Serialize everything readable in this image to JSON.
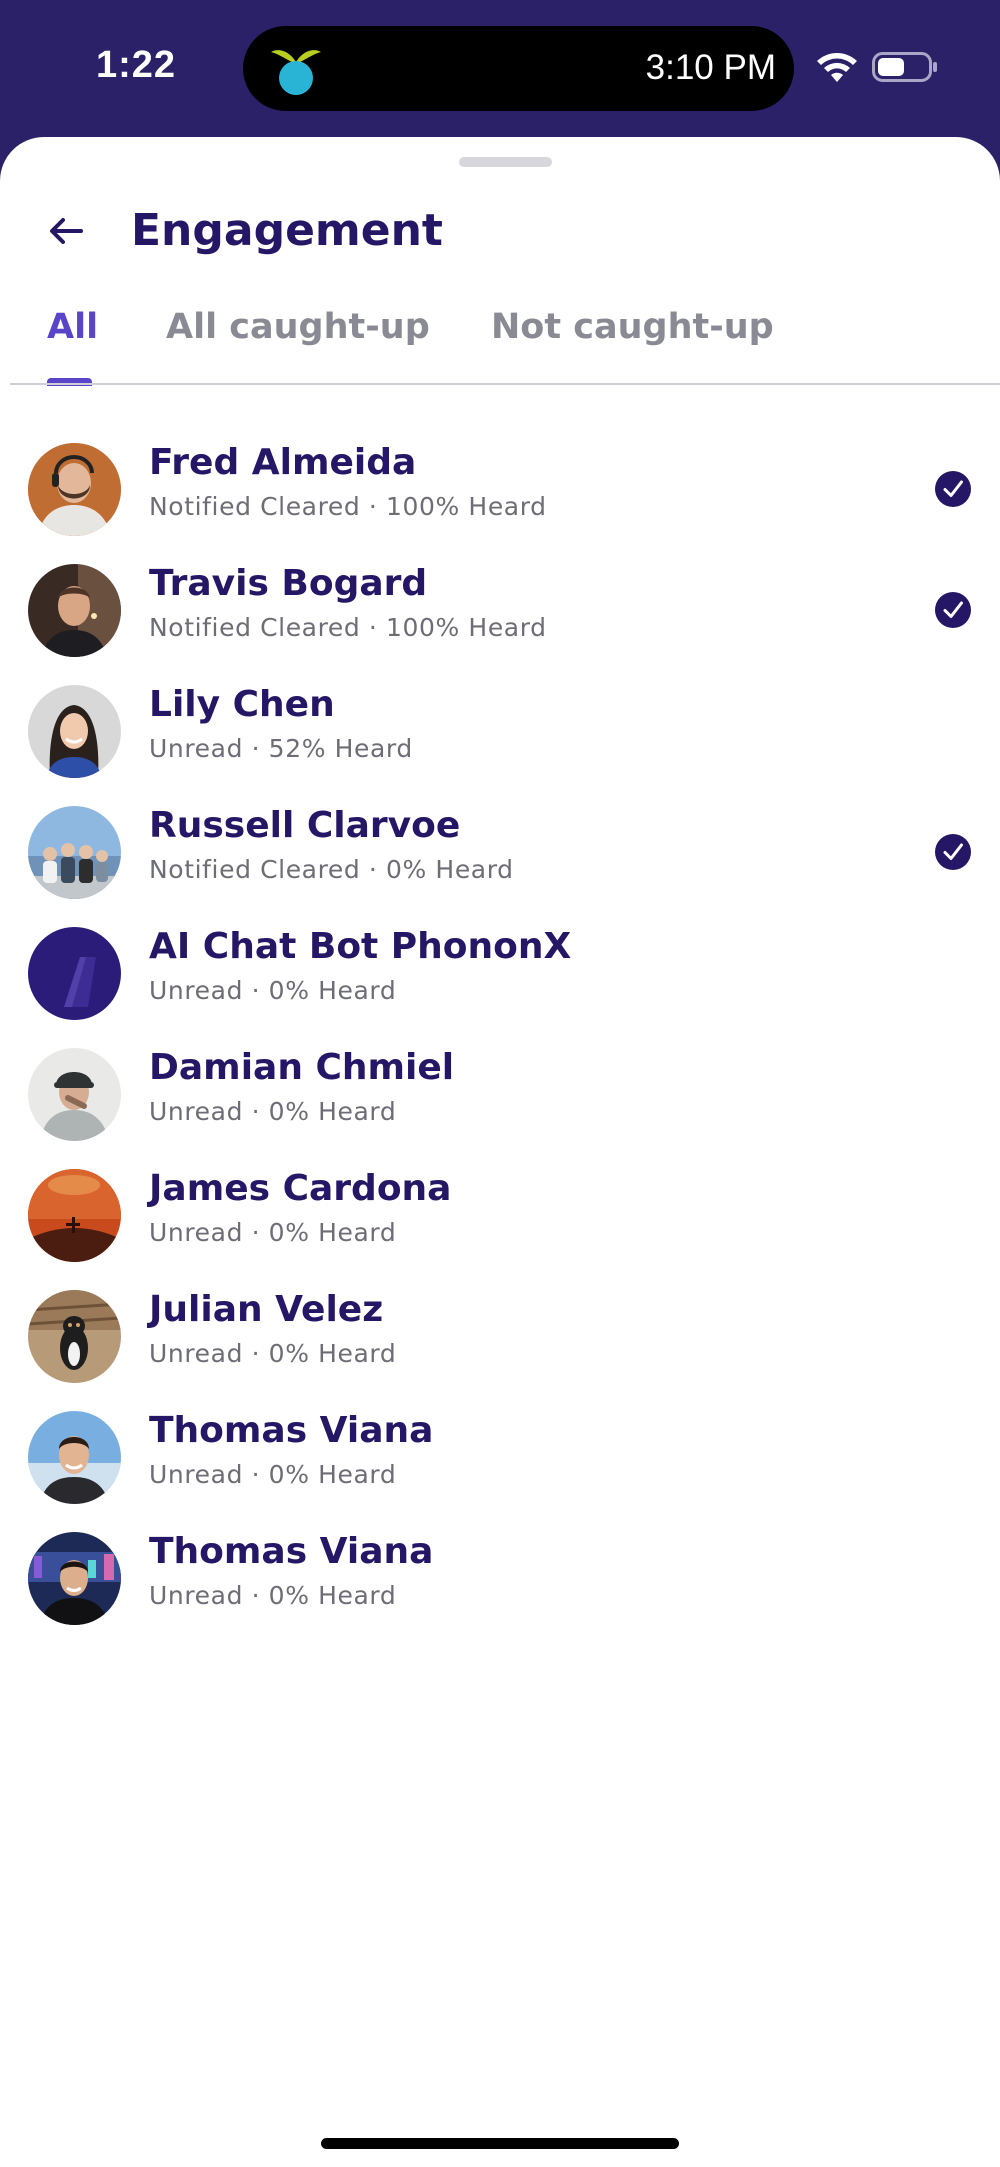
{
  "status_bar": {
    "time": "1:22",
    "island_time": "3:10 PM",
    "app_icon": "sprout-app-icon",
    "wifi_icon": "wifi-icon",
    "battery_icon": "battery-icon"
  },
  "header": {
    "back_icon": "arrow-left-icon",
    "title": "Engagement"
  },
  "tabs": [
    {
      "label": "All",
      "active": true
    },
    {
      "label": "All caught-up",
      "active": false
    },
    {
      "label": "Not caught-up",
      "active": false
    }
  ],
  "members": [
    {
      "name": "Fred Almeida",
      "status": "Notified Cleared · 100% Heard",
      "checked": true
    },
    {
      "name": "Travis Bogard",
      "status": "Notified Cleared · 100% Heard",
      "checked": true
    },
    {
      "name": "Lily Chen",
      "status": "Unread · 52% Heard",
      "checked": false
    },
    {
      "name": "Russell Clarvoe",
      "status": "Notified Cleared · 0% Heard",
      "checked": true
    },
    {
      "name": "AI Chat Bot PhononX",
      "status": "Unread · 0% Heard",
      "checked": false
    },
    {
      "name": "Damian Chmiel",
      "status": "Unread · 0% Heard",
      "checked": false
    },
    {
      "name": "James Cardona",
      "status": "Unread · 0% Heard",
      "checked": false
    },
    {
      "name": "Julian Velez",
      "status": "Unread · 0% Heard",
      "checked": false
    },
    {
      "name": "Thomas Viana",
      "status": "Unread · 0% Heard",
      "checked": false
    },
    {
      "name": "Thomas Viana",
      "status": "Unread · 0% Heard",
      "checked": false
    }
  ],
  "colors": {
    "brand_dark": "#2b2168",
    "title": "#251765",
    "accent": "#5a45c9",
    "muted": "#8a8a94",
    "check": "#251765"
  }
}
